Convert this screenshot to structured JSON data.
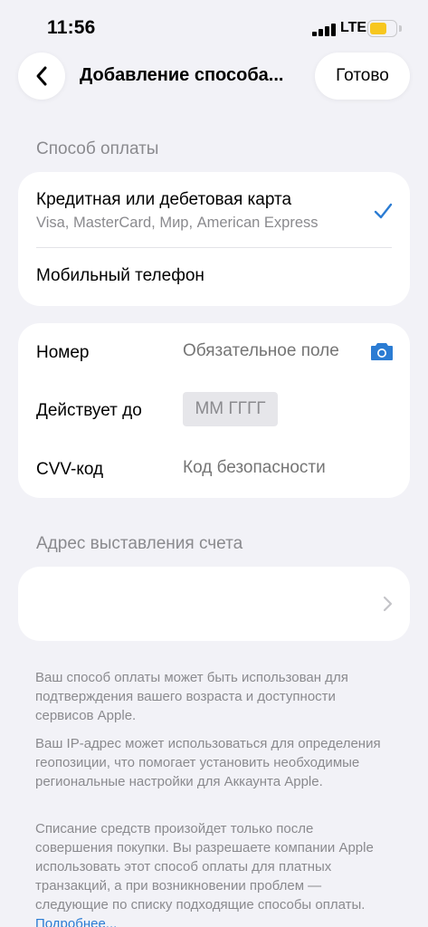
{
  "status_bar": {
    "time": "11:56",
    "network": "LTE",
    "battery_level": 0.7,
    "battery_color": "#f7c71f"
  },
  "nav": {
    "title": "Добавление способа...",
    "done_label": "Готово",
    "back_icon": "chevron-left-icon"
  },
  "payment": {
    "section_label": "Способ оплаты",
    "options": [
      {
        "title": "Кредитная или дебетовая карта",
        "subtitle": "Visa, MasterCard, Мир, American Express",
        "selected": true
      },
      {
        "title": "Мобильный телефон",
        "selected": false
      }
    ],
    "accent_color": "#2b7cd3"
  },
  "card_form": {
    "number_label": "Номер",
    "number_placeholder": "Обязательное поле",
    "expiry_label": "Действует до",
    "expiry_placeholder": "ММ ГГГГ",
    "cvv_label": "CVV-код",
    "cvv_placeholder": "Код безопасности",
    "camera_icon": "camera-icon"
  },
  "billing": {
    "section_label": "Адрес выставления счета",
    "value": ""
  },
  "footnotes": {
    "p1": "Ваш способ оплаты может быть использован для подтверждения вашего возраста и доступности сервисов Apple.",
    "p2": "Ваш IP-адрес может использоваться для определения геопозиции, что помогает установить необходимые региональные настройки для Аккаунта Apple.",
    "p3": "Списание средств произойдет только после совершения покупки. Вы разрешаете компании Apple использовать этот способ оплаты для платных транзакций, а при возникновении проблем — следующие по списку подходящие способы оплаты.",
    "link": "Подробнее..."
  }
}
